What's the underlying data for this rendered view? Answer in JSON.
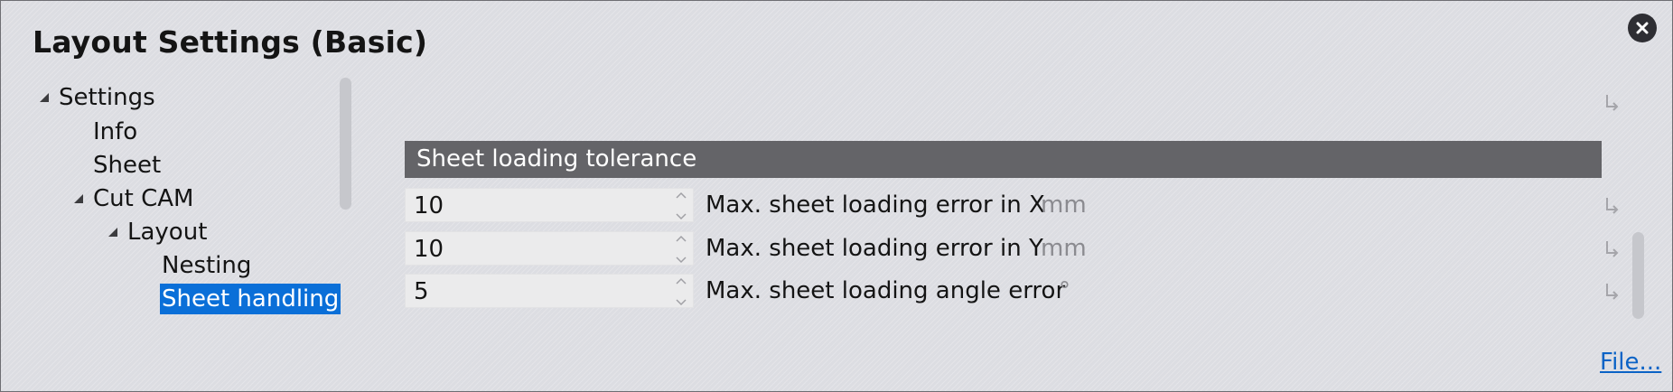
{
  "window": {
    "title": "Layout Settings (Basic)"
  },
  "tree": {
    "items": [
      {
        "label": "Settings",
        "level": 0,
        "expanded": true
      },
      {
        "label": "Info",
        "level": 1
      },
      {
        "label": "Sheet",
        "level": 1
      },
      {
        "label": "Cut CAM",
        "level": 1,
        "expanded": true
      },
      {
        "label": "Layout",
        "level": 2,
        "expanded": true
      },
      {
        "label": "Nesting",
        "level": 3
      },
      {
        "label": "Sheet handling",
        "level": 3,
        "selected": true
      }
    ]
  },
  "section": {
    "header": "Sheet loading tolerance",
    "rows": [
      {
        "value": "10",
        "label": "Max. sheet loading error in X",
        "unit": "mm"
      },
      {
        "value": "10",
        "label": "Max. sheet loading error in Y",
        "unit": "mm"
      },
      {
        "value": "5",
        "label": "Max. sheet loading angle error",
        "unit": "°"
      }
    ]
  },
  "footer": {
    "file_link": "File..."
  },
  "colors": {
    "background": "#dcdde2",
    "header_bg": "#646468",
    "selection": "#0a6fd8",
    "link": "#0b63c6",
    "close_button": "#2e2e33"
  },
  "icons": {
    "close": "close-x-icon",
    "expander": "expanded-triangle-icon",
    "reset": "reset-arrow-icon",
    "spinner": "spinner-arrows-icon"
  }
}
